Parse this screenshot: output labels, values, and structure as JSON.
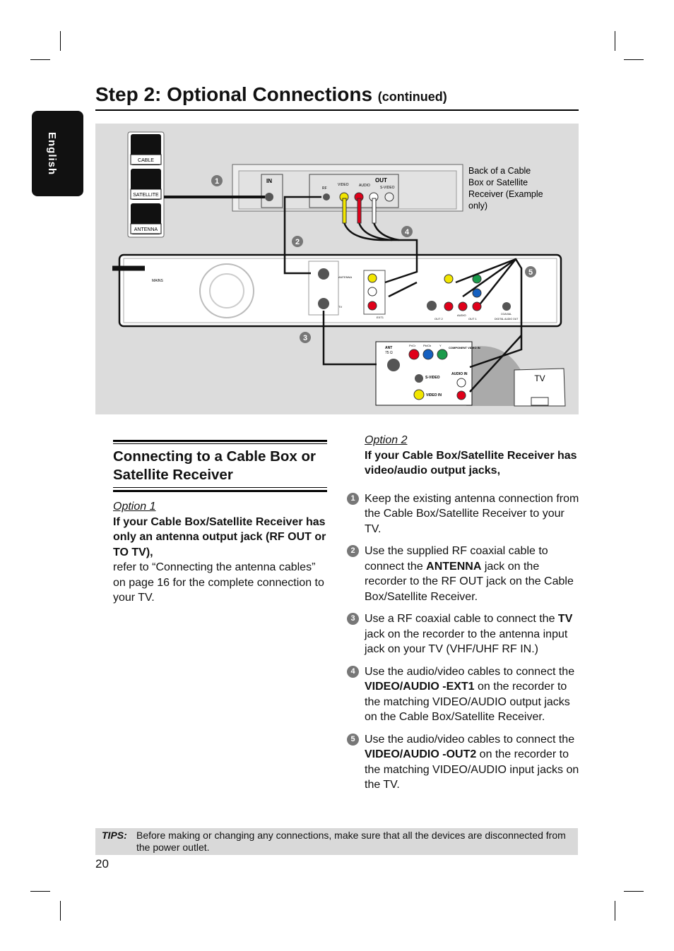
{
  "header": {
    "title": "Step 2: Optional Connections",
    "title_suffix": "(continued)",
    "language_tab": "English"
  },
  "diagram": {
    "source_icons": [
      "CABLE",
      "SATELLITE",
      "ANTENNA"
    ],
    "receiver_caption": "Back of a Cable Box or Satellite Receiver (Example only)",
    "receiver_labels": {
      "in": "IN",
      "out": "OUT",
      "rf": "RF",
      "video": "VIDEO",
      "audio": "AUDIO",
      "r": "R",
      "l": "L",
      "svideo": "S-VIDEO"
    },
    "recorder_labels": {
      "mains": "MAINS",
      "antenna": "ANTENNA",
      "tv": "TV",
      "ext1": "EXT1",
      "out2": "OUT 2",
      "out1": "OUT 1",
      "audio": "AUDIO",
      "coaxial": "COAXIAL",
      "digital": "DIGITAL AUDIO OUT"
    },
    "tv_labels": {
      "ant": "ANT",
      "ohm": "75 Ω",
      "prcr": "Pr/Cr",
      "pbcb": "Pb/Cb",
      "y": "Y",
      "component": "COMPONENT VIDEO IN",
      "svideo": "S-VIDEO",
      "audio_in": "AUDIO IN",
      "video_in": "VIDEO IN",
      "tv": "TV"
    },
    "callouts": [
      "1",
      "2",
      "3",
      "4",
      "5"
    ],
    "colors": {
      "yellow": "#f2e600",
      "red": "#e0001a",
      "white": "#ffffff",
      "green": "#1a9a4a",
      "blue": "#1560c0"
    }
  },
  "left": {
    "heading": "Connecting to a Cable Box or Satellite Receiver",
    "option_label": "Option 1",
    "option_title": "If your Cable Box/Satellite Receiver has only an antenna output jack (RF OUT or TO TV),",
    "option_body": "refer to “Connecting the antenna cables” on page 16 for the complete connection to your TV."
  },
  "right": {
    "option_label": "Option 2",
    "option_title": "If your Cable Box/Satellite Receiver has video/audio output jacks,",
    "steps": [
      {
        "num": "1",
        "pre": "Keep the existing antenna connection from the Cable Box/Satellite Receiver to your TV.",
        "bold": "",
        "post": ""
      },
      {
        "num": "2",
        "pre": "Use the supplied RF coaxial cable to connect the ",
        "bold": "ANTENNA",
        "post": " jack on the recorder to the RF OUT jack on the Cable Box/Satellite Receiver."
      },
      {
        "num": "3",
        "pre": "Use a RF coaxial cable to connect the ",
        "bold": "TV",
        "post": " jack on the recorder to the antenna input jack on your TV (VHF/UHF RF IN.)"
      },
      {
        "num": "4",
        "pre": "Use the audio/video cables to connect the ",
        "bold": "VIDEO/AUDIO -EXT1",
        "post": " on the recorder to the matching VIDEO/AUDIO output jacks on the Cable Box/Satellite Receiver."
      },
      {
        "num": "5",
        "pre": "Use the audio/video cables to connect the ",
        "bold": "VIDEO/AUDIO -OUT2",
        "post": " on the recorder to the matching VIDEO/AUDIO input jacks on the TV."
      }
    ]
  },
  "tips": {
    "label": "TIPS:",
    "text": "Before making or changing any connections, make sure that all the devices are disconnected from the power outlet."
  },
  "page_number": "20"
}
